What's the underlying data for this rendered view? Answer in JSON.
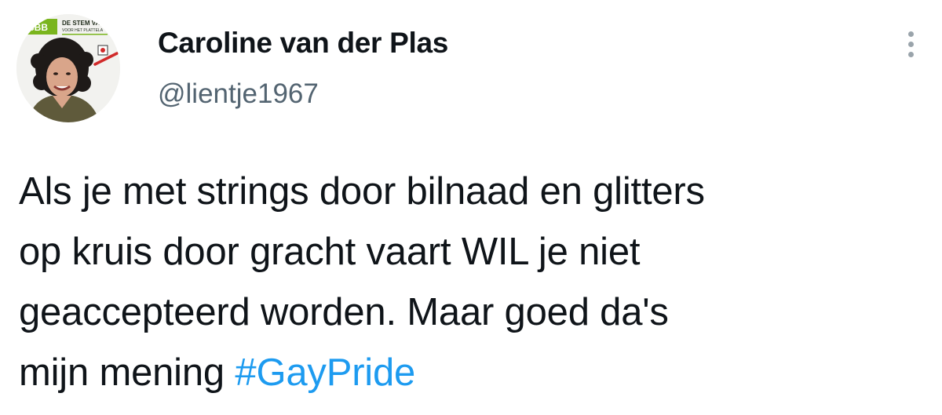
{
  "author": {
    "display_name": "Caroline van der Plas",
    "handle": "@lientje1967",
    "avatar_badge_text": "BBB",
    "avatar_badge_caption": "DE STEM VAN",
    "avatar_badge_subcaption": "VOOR HET PLATTELA"
  },
  "tweet": {
    "lines": [
      "Als je met strings door bilnaad en glitters",
      "op kruis door gracht vaart WIL je niet",
      "geaccepteerd worden. Maar goed da's",
      "mijn mening "
    ],
    "hashtag": "#GayPride"
  },
  "colors": {
    "hashtag": "#1d9bf0",
    "handle": "#536471",
    "text": "#0f1419",
    "badge_green": "#7ab51d"
  },
  "icons": {
    "more": "more-vertical-icon"
  }
}
